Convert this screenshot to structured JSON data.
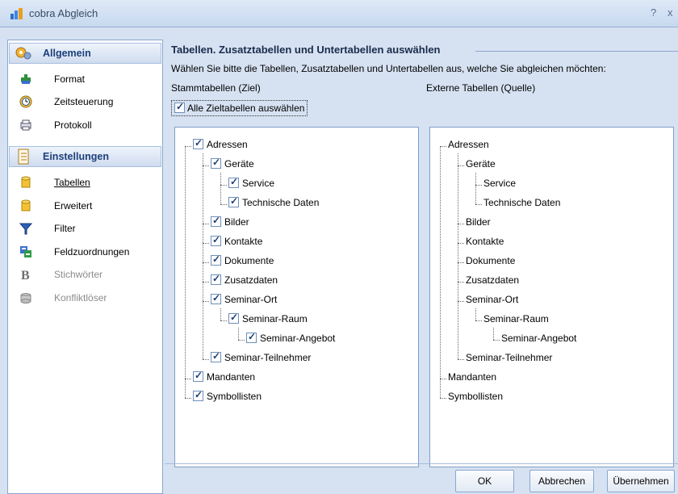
{
  "window": {
    "title": "cobra Abgleich",
    "help_glyph": "?",
    "close_glyph": "x"
  },
  "sidebar": {
    "sections": [
      {
        "label": "Allgemein",
        "items": [
          {
            "label": "Format",
            "icon": "format-icon"
          },
          {
            "label": "Zeitsteuerung",
            "icon": "clock-icon"
          },
          {
            "label": "Protokoll",
            "icon": "protocol-icon"
          }
        ]
      },
      {
        "label": "Einstellungen",
        "items": [
          {
            "label": "Tabellen",
            "icon": "database-icon",
            "active": true
          },
          {
            "label": "Erweitert",
            "icon": "database-icon"
          },
          {
            "label": "Filter",
            "icon": "filter-icon"
          },
          {
            "label": "Feldzuordnungen",
            "icon": "field-mapping-icon"
          },
          {
            "label": "Stichwörter",
            "icon": "bold-b-icon",
            "disabled": true
          },
          {
            "label": "Konfliktlöser",
            "icon": "conflict-icon",
            "disabled": true
          }
        ]
      }
    ]
  },
  "main": {
    "heading": "Tabellen. Zusatztabellen und Untertabellen auswählen",
    "instruction": "Wählen Sie bitte die Tabellen, Zusatztabellen und Untertabellen aus, welche Sie abgleichen möchten:",
    "left_label": "Stammtabellen (Ziel)",
    "right_label": "Externe Tabellen (Quelle)",
    "select_all_label": "Alle Zieltabellen auswählen",
    "tree": [
      {
        "label": "Adressen",
        "level": 0
      },
      {
        "label": "Geräte",
        "level": 1
      },
      {
        "label": "Service",
        "level": 2
      },
      {
        "label": "Technische Daten",
        "level": 2
      },
      {
        "label": "Bilder",
        "level": 1
      },
      {
        "label": "Kontakte",
        "level": 1
      },
      {
        "label": "Dokumente",
        "level": 1
      },
      {
        "label": "Zusatzdaten",
        "level": 1
      },
      {
        "label": "Seminar-Ort",
        "level": 1
      },
      {
        "label": "Seminar-Raum",
        "level": 2
      },
      {
        "label": "Seminar-Angebot",
        "level": 3
      },
      {
        "label": "Seminar-Teilnehmer",
        "level": 1
      },
      {
        "label": "Mandanten",
        "level": 0
      },
      {
        "label": "Symbollisten",
        "level": 0
      }
    ]
  },
  "buttons": {
    "ok": "OK",
    "cancel": "Abbrechen",
    "apply": "Übernehmen"
  },
  "colors": {
    "accent": "#1c3f7a",
    "panel_bg": "#d6e2f2",
    "border": "#8aa6cf"
  }
}
